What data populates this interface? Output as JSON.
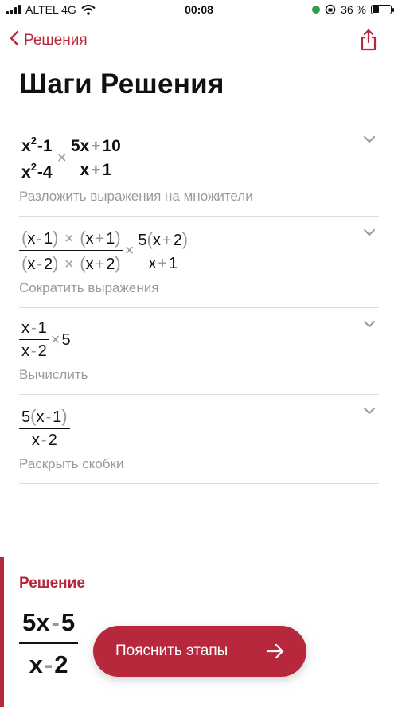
{
  "status": {
    "carrier": "ALTEL 4G",
    "time": "00:08",
    "battery_text": "36 %",
    "battery_level": 0.36
  },
  "nav": {
    "back_label": "Решения"
  },
  "page_title": "Шаги Решения",
  "steps": [
    {
      "description": "Разложить выражения на множители",
      "expr": {
        "f1_num_base": "x",
        "f1_num_exp": "2",
        "f1_num_rest": "-1",
        "f1_den_base": "x",
        "f1_den_exp": "2",
        "f1_den_rest": "-4",
        "times": "×",
        "f2_num_a": "5x",
        "f2_num_op": "+",
        "f2_num_b": "10",
        "f2_den_a": "x",
        "f2_den_op": "+",
        "f2_den_b": "1"
      }
    },
    {
      "description": "Сократить выражения",
      "expr": {
        "open": "(",
        "close": ")",
        "times": "×",
        "n1": "x",
        "n1op": "-",
        "n1b": "1",
        "n2": "x",
        "n2op": "+",
        "n2b": "1",
        "d1": "x",
        "d1op": "-",
        "d1b": "2",
        "d2": "x",
        "d2op": "+",
        "d2b": "2",
        "f2_coef": "5",
        "f2_a": "x",
        "f2_op": "+",
        "f2_b": "2",
        "f2_den_a": "x",
        "f2_den_op": "+",
        "f2_den_b": "1"
      }
    },
    {
      "description": "Вычислить",
      "expr": {
        "num_a": "x",
        "num_op": "-",
        "num_b": "1",
        "den_a": "x",
        "den_op": "-",
        "den_b": "2",
        "times": "×",
        "factor": "5"
      }
    },
    {
      "description": "Раскрыть скобки",
      "expr": {
        "coef": "5",
        "open": "(",
        "close": ")",
        "num_a": "x",
        "num_op": "-",
        "num_b": "1",
        "den_a": "x",
        "den_op": "-",
        "den_b": "2"
      }
    }
  ],
  "solution": {
    "label": "Решение",
    "num_a": "5x",
    "num_op": "-",
    "num_b": "5",
    "den_a": "x",
    "den_op": "-",
    "den_b": "2"
  },
  "cta": {
    "label": "Пояснить этапы"
  },
  "colors": {
    "accent": "#b8283c",
    "muted": "#9a9a9a"
  }
}
